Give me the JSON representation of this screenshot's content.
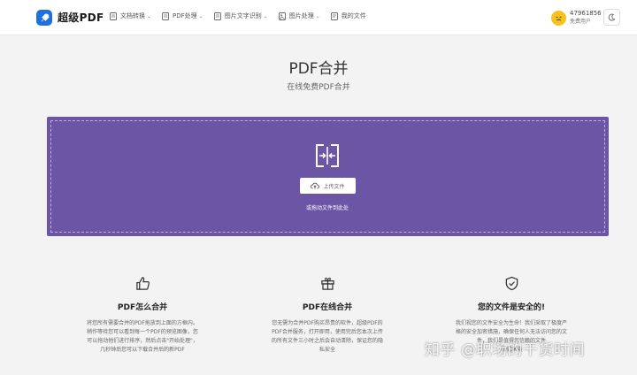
{
  "header": {
    "brand": "超级PDF",
    "logo_icon": "rocket-icon",
    "nav": [
      {
        "label": "文档转换",
        "icon": "doc-icon",
        "has_caret": true
      },
      {
        "label": "PDF处理",
        "icon": "doc-icon",
        "has_caret": true
      },
      {
        "label": "图片文字识别",
        "icon": "doc-icon",
        "has_caret": true
      },
      {
        "label": "图片处理",
        "icon": "image-icon",
        "has_caret": true
      },
      {
        "label": "我的文件",
        "icon": "folder-icon",
        "has_caret": false
      }
    ],
    "user": {
      "id": "47961856",
      "role": "免费用户"
    },
    "theme_icon": "moon-icon"
  },
  "main": {
    "title": "PDF合并",
    "subtitle": "在线免费PDF合并",
    "upload": {
      "button_label": "上传文件",
      "hint": "或拖动文件到此处",
      "background": "#6b55a4"
    }
  },
  "features": [
    {
      "icon": "thumbs-up-icon",
      "title": "PDF怎么合并",
      "lines": [
        "将您所有需要合并的PDF拖放到上面的方框内。",
        "稍作等待您可以看到每一个PDF的预览图像，您",
        "可以拖动他们进行排序，然后点击\"开始处理\"，",
        "几秒钟后您可以下载合并后的新PDF"
      ]
    },
    {
      "icon": "gift-icon",
      "title": "PDF在线合并",
      "lines": [
        "您无需为合并PDF购买昂贵的软件，超级PDF的",
        "PDF合并服务，打开即用，使用完后您本次上传",
        "的所有文件三小时之后会自动清除，保证您的隐",
        "私安全"
      ]
    },
    {
      "icon": "shield-check-icon",
      "title": "您的文件是安全的!",
      "lines": [
        "我们视您的文件安全为生命！我们采取了极度严",
        "格的安全加密措施，确保任何人无法访问您的文",
        "件，我们是值得您信赖的文件",
        "我们承诺"
      ]
    }
  ],
  "watermark": "知乎 @职场的干货时间"
}
